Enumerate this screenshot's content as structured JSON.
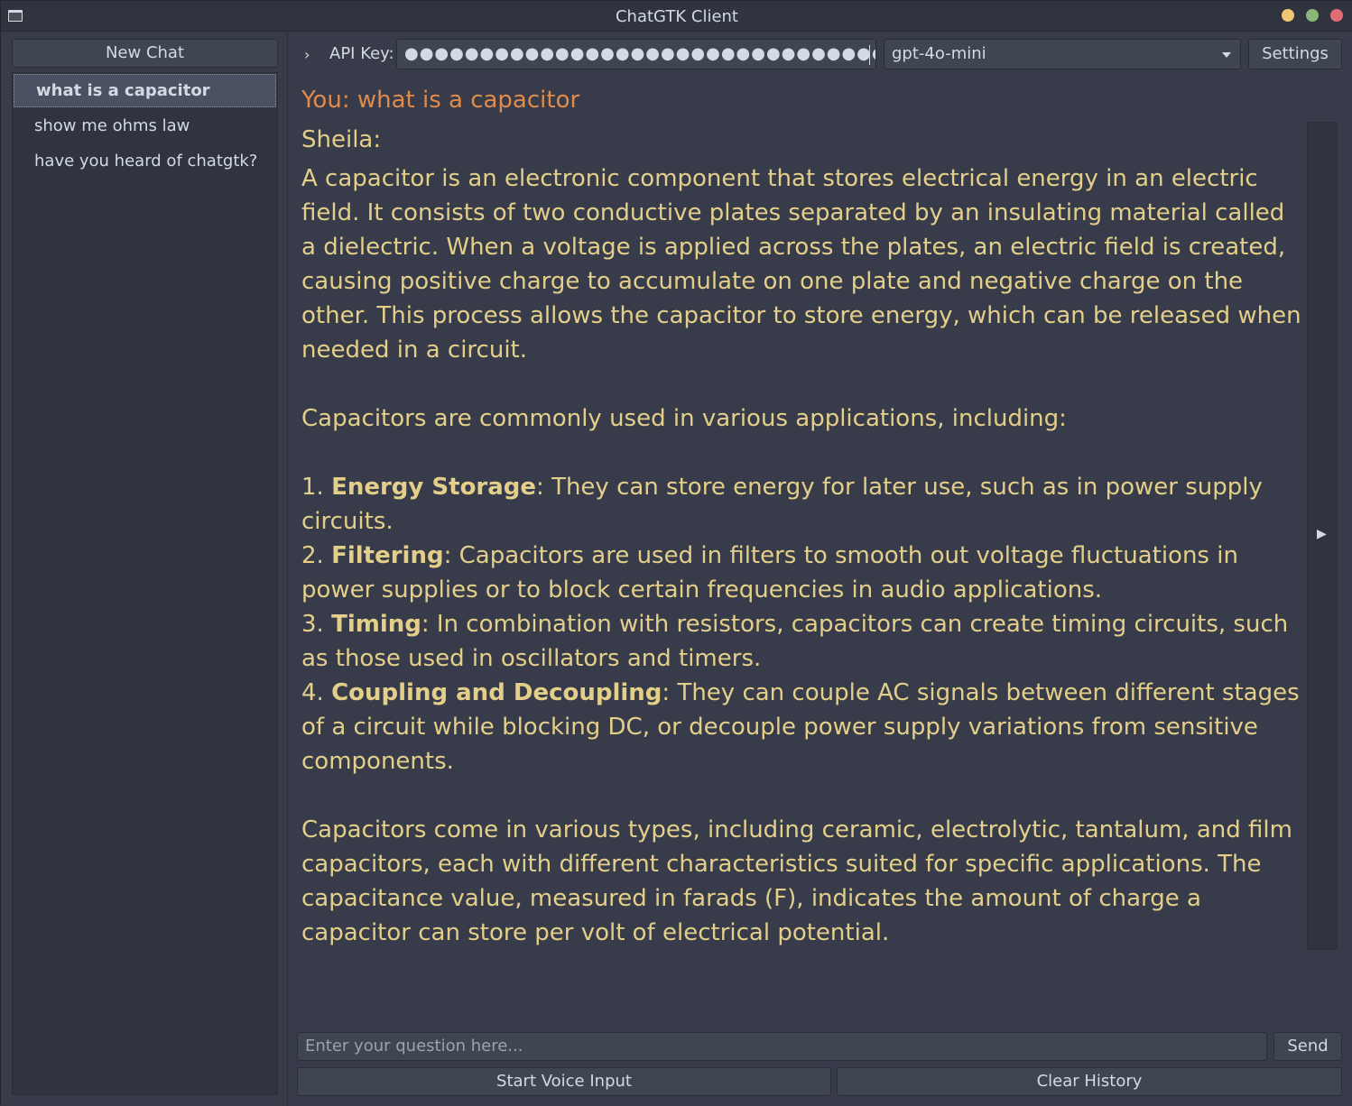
{
  "window": {
    "title": "ChatGTK Client"
  },
  "sidebar": {
    "new_chat_label": "New Chat",
    "items": [
      {
        "label": "what is a capacitor"
      },
      {
        "label": "show me ohms law"
      },
      {
        "label": "have you heard of chatgtk?"
      }
    ]
  },
  "toolbar": {
    "expander_icon": "›",
    "api_label": "API Key:",
    "api_value": "●●●●●●●●●●●●●●●●●●●●●●●●●●●●●●●●●●●●●●●●●●●",
    "model_selected": "gpt-4o-mini",
    "settings_label": "Settings"
  },
  "chat": {
    "user_message": "You: what is a capacitor",
    "assistant_name": "Sheila:",
    "intro_paragraph": "A capacitor is an electronic component that stores electrical energy in an electric field. It consists of two conductive plates separated by an insulating material called a dielectric. When a voltage is applied across the plates, an electric field is created, causing positive charge to accumulate on one plate and negative charge on the other. This process allows the capacitor to store energy, which can be released when needed in a circuit.",
    "applications_intro": "Capacitors are commonly used in various applications, including:",
    "list": [
      {
        "num": "1. ",
        "term": "Energy Storage",
        "text": ": They can store energy for later use, such as in power supply circuits."
      },
      {
        "num": "2. ",
        "term": "Filtering",
        "text": ": Capacitors are used in filters to smooth out voltage fluctuations in power supplies or to block certain frequencies in audio applications."
      },
      {
        "num": "3. ",
        "term": "Timing",
        "text": ": In combination with resistors, capacitors can create timing circuits, such as those used in oscillators and timers."
      },
      {
        "num": "4. ",
        "term": "Coupling and Decoupling",
        "text": ": They can couple AC signals between different stages of a circuit while blocking DC, or decouple power supply variations from sensitive components."
      }
    ],
    "closing_paragraph": "Capacitors come in various types, including ceramic, electrolytic, tantalum, and film capacitors, each with different characteristics suited for specific applications. The capacitance value, measured in farads (F), indicates the amount of charge a capacitor can store per volt of electrical potential.",
    "side_panel_arrow": "▶"
  },
  "input": {
    "placeholder": "Enter your question here...",
    "send_label": "Send",
    "voice_label": "Start Voice Input",
    "clear_label": "Clear History"
  },
  "colors": {
    "user_text": "#e08a4c",
    "assistant_text": "#e3cf8a",
    "background": "#383c4a"
  }
}
